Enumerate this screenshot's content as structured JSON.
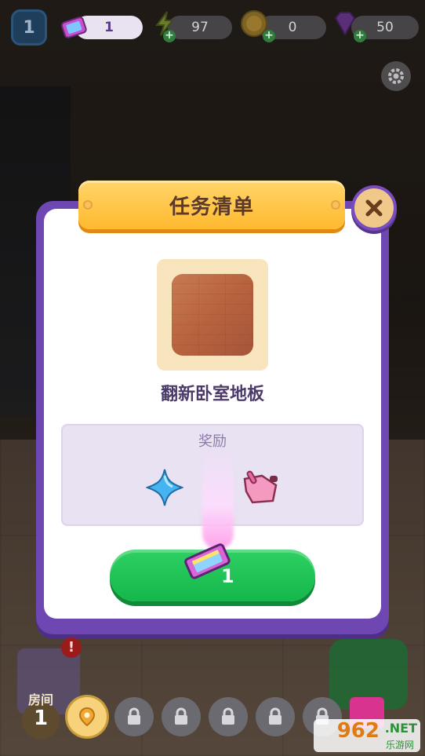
{
  "hud": {
    "level": "1",
    "tickets": "1",
    "energy": "97",
    "coins": "0",
    "gems": "50"
  },
  "dialog": {
    "title": "任务清单",
    "task_name": "翻新卧室地板",
    "reward_label": "奖励",
    "button_count": "1"
  },
  "bottom_bar": {
    "room_label": "房间",
    "room_number": "1"
  },
  "watermark": {
    "brand": "962",
    "domain": ".NET",
    "subtitle": "乐游网"
  },
  "colors": {
    "modal_purple": "#6f47b3",
    "ribbon_gold": "#ffb92e",
    "button_green": "#14b74b"
  },
  "icons": [
    "level-badge-icon",
    "ticket-icon",
    "energy-icon",
    "coin-icon",
    "gem-icon",
    "settings-icon",
    "close-icon",
    "blue-star-icon",
    "pink-glove-icon",
    "lock-icon",
    "map-pin-icon",
    "gift-icon"
  ]
}
